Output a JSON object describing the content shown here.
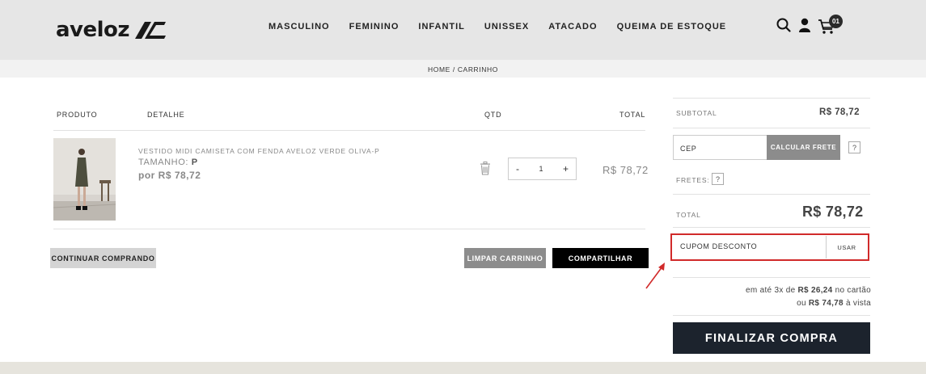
{
  "header": {
    "logo_text": "aveloz",
    "nav": [
      "MASCULINO",
      "FEMININO",
      "INFANTIL",
      "UNISSEX",
      "ATACADO",
      "QUEIMA DE ESTOQUE"
    ],
    "icons": [
      "search-icon",
      "user-icon",
      "cart-icon"
    ],
    "cart_count": "01"
  },
  "breadcrumb": "HOME / CARRINHO",
  "table": {
    "headers": {
      "produto": "PRODUTO",
      "detalhe": "DETALHE",
      "qtd": "QTD",
      "total": "TOTAL"
    },
    "item": {
      "name": "VESTIDO MIDI CAMISETA COM FENDA AVELOZ VERDE OLIVA-P",
      "size_label": "TAMANHO:",
      "size_value": "P",
      "price": "por R$ 78,72",
      "qty_minus": "-",
      "qty_value": "1",
      "qty_plus": "+",
      "total": "R$ 78,72"
    }
  },
  "actions": {
    "continue": "CONTINUAR COMPRANDO",
    "clear": "LIMPAR CARRINHO",
    "share": "COMPARTILHAR"
  },
  "summary": {
    "subtotal_label": "SUBTOTAL",
    "subtotal_value": "R$ 78,72",
    "cep_placeholder": "CEP",
    "calc_frete": "CALCULAR FRETE",
    "help": "?",
    "fretes_label": "FRETES:",
    "total_label": "TOTAL",
    "total_value": "R$ 78,72",
    "coupon_placeholder": "CUPOM DESCONTO",
    "coupon_button": "USAR",
    "installments_pre": "em até 3x de ",
    "installments_value": "R$ 26,24",
    "installments_post": " no cartão",
    "cash_pre": "ou ",
    "cash_value": "R$ 74,78",
    "cash_post": " à vista",
    "checkout": "FINALIZAR COMPRA"
  },
  "colors": {
    "accent_dark": "#1c232d",
    "highlight": "#d12a2a",
    "header_bg": "#e6e6e6"
  }
}
